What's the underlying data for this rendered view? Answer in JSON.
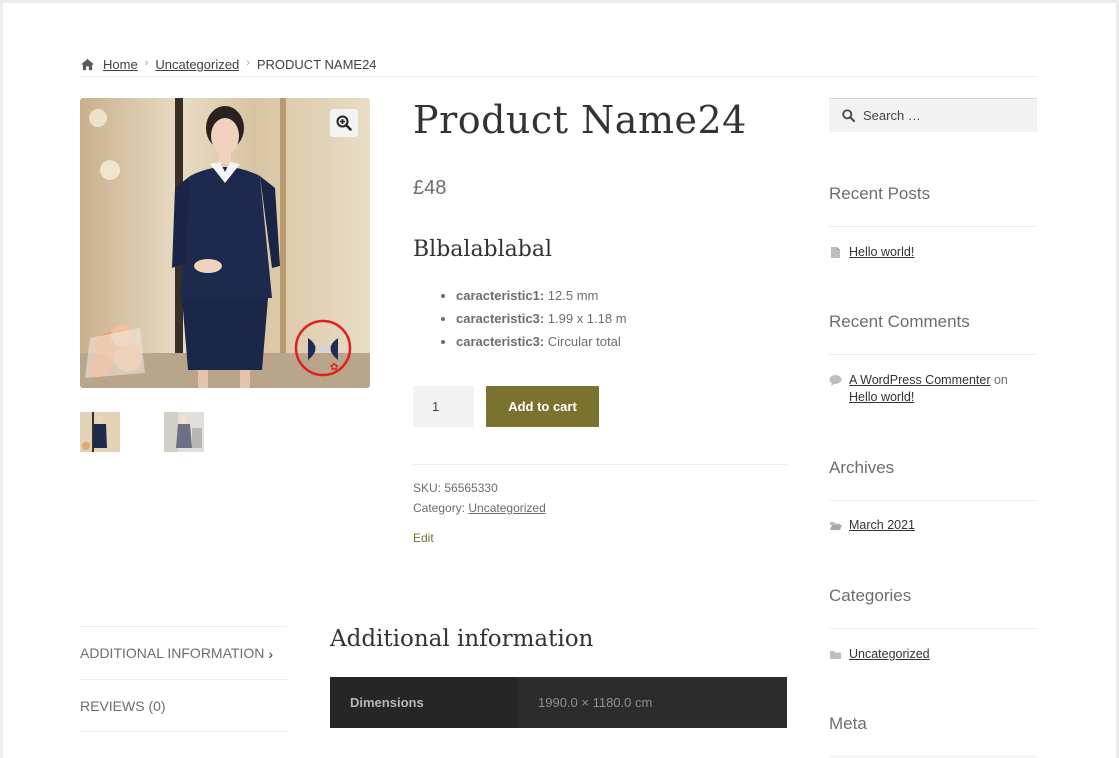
{
  "breadcrumb": {
    "home": "Home",
    "category": "Uncategorized",
    "current": "PRODUCT NAME24",
    "separator": "›"
  },
  "product": {
    "title": "Product Name24",
    "price": "£48",
    "subtitle": "Blbalablabal",
    "features": [
      {
        "label": "caracteristic1:",
        "value": " 12.5 mm"
      },
      {
        "label": "caracteristic3:",
        "value": " 1.99 x 1.18 m"
      },
      {
        "label": "caracteristic3:",
        "value": " Circular total"
      }
    ],
    "quantity": "1",
    "add_to_cart": "Add to cart",
    "sku_label": "SKU:",
    "sku_value": " 56565330",
    "category_label": "Category:",
    "category_value": "Uncategorized",
    "edit": "Edit"
  },
  "tabs": {
    "items": [
      {
        "label": "ADDITIONAL INFORMATION",
        "chevron": "›"
      },
      {
        "label": "REVIEWS (0)"
      }
    ],
    "panel_title": "Additional information",
    "attributes": [
      {
        "name": "Dimensions",
        "value": "1990.0 × 1180.0 cm"
      }
    ]
  },
  "sidebar": {
    "search_placeholder": "Search …",
    "recent_posts": {
      "title": "Recent Posts",
      "items": [
        "Hello world!"
      ]
    },
    "recent_comments": {
      "title": "Recent Comments",
      "author": "A WordPress Commenter",
      "on": " on",
      "post": "Hello world!"
    },
    "archives": {
      "title": "Archives",
      "items": [
        "March 2021"
      ]
    },
    "categories": {
      "title": "Categories",
      "items": [
        "Uncategorized"
      ]
    },
    "meta": {
      "title": "Meta"
    }
  },
  "colors": {
    "accent": "#7c722f",
    "text": "#6d6d6d",
    "heading": "#333333",
    "table_dark": "#262626"
  }
}
